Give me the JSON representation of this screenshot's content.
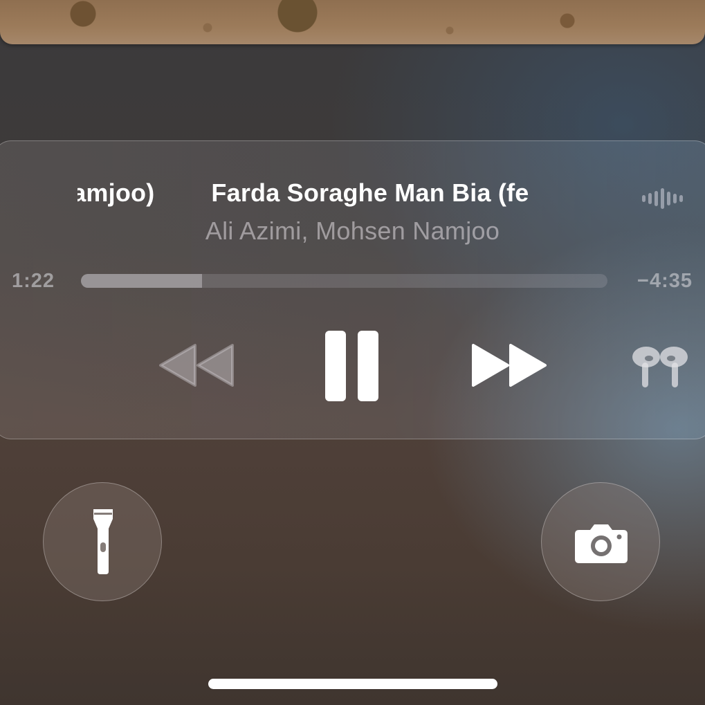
{
  "now_playing": {
    "title": "Farda Soraghe Man Bia (feat. Mohsen Namjoo)",
    "title_visible_tail": "lamjoo)",
    "title_visible_head": "Farda Soraghe Man Bia (fe",
    "artist": "Ali Azimi, Mohsen Namjoo",
    "elapsed": "1:22",
    "remaining": "−4:35",
    "progress_fraction": 0.23
  },
  "controls": {
    "rewind_icon": "backward-icon",
    "pause_icon": "pause-icon",
    "forward_icon": "forward-icon",
    "output_icon": "airpods-pro-icon",
    "waveform_icon": "waveform-icon"
  },
  "lockscreen": {
    "flashlight_icon": "flashlight-icon",
    "camera_icon": "camera-icon"
  },
  "colors": {
    "primary_text": "#ffffff",
    "secondary_text": "#d6d2d6"
  }
}
